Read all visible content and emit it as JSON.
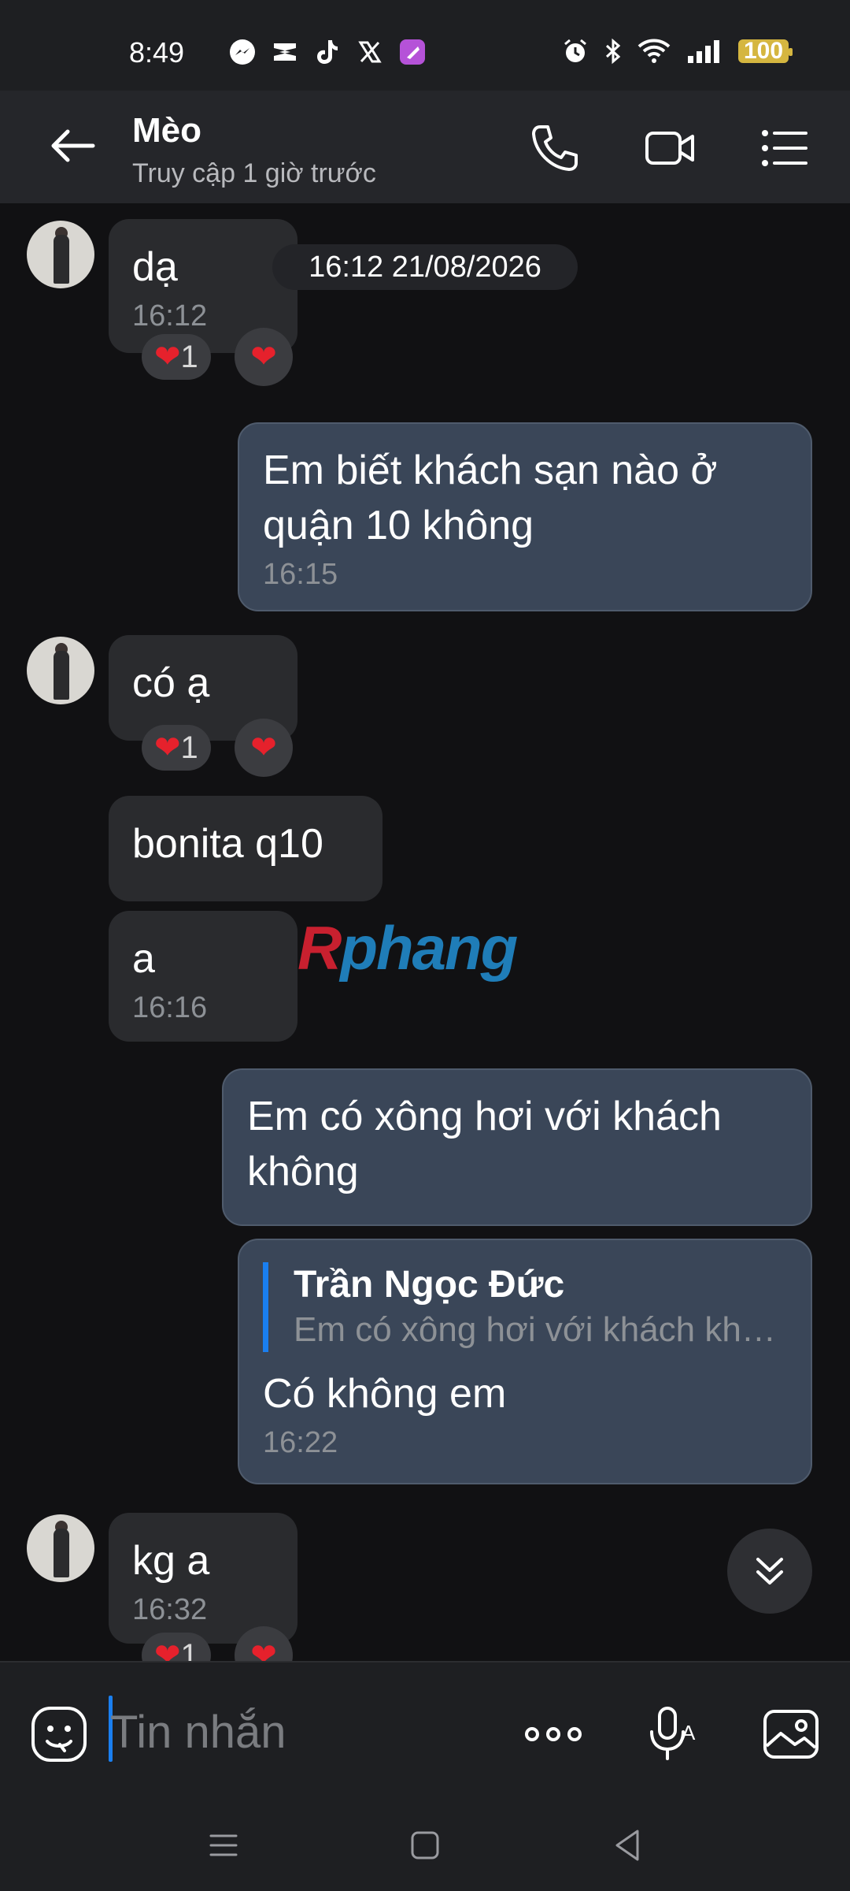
{
  "status_bar": {
    "time": "8:49",
    "battery": "100",
    "app_icons": [
      "messenger-icon",
      "capcut-icon",
      "tiktok-icon",
      "x-icon",
      "shortcut-app-icon"
    ],
    "system_icons": [
      "alarm-icon",
      "bluetooth-icon",
      "wifi-icon",
      "signal-icon",
      "battery-icon"
    ]
  },
  "header": {
    "name": "Mèo",
    "status": "Truy cập 1 giờ trước",
    "icons": [
      "back-arrow-icon",
      "phone-icon",
      "video-call-icon",
      "menu-list-icon"
    ]
  },
  "chat": {
    "date_separator": "16:12 21/08/2026",
    "messages": [
      {
        "from": "other",
        "text": "dạ",
        "time": "16:12",
        "reaction_count": "1"
      },
      {
        "from": "me",
        "text": "Em biết khách sạn nào ở quận 10 không",
        "time": "16:15"
      },
      {
        "from": "other",
        "text": "có ạ",
        "reaction_count": "1"
      },
      {
        "from": "other",
        "text": "bonita q10"
      },
      {
        "from": "other",
        "text": "a",
        "time": "16:16"
      },
      {
        "from": "me",
        "text": "Em có xông hơi với khách không"
      },
      {
        "from": "me",
        "reply_author": "Trần Ngọc Đức",
        "reply_text": "Em có xông hơi với khách không",
        "text": "Có không em",
        "time": "16:22"
      },
      {
        "from": "other",
        "text": "kg a",
        "time": "16:32",
        "reaction_count": "1"
      }
    ]
  },
  "watermark": {
    "part1": "R",
    "part2": "phang"
  },
  "composer": {
    "placeholder": "Tin nhắn",
    "icons": [
      "emoji-sticker-icon",
      "more-options-icon",
      "voice-to-text-icon",
      "image-gallery-icon"
    ]
  },
  "colors": {
    "background": "#111113",
    "incoming_bubble": "#2a2b2e",
    "outgoing_bubble": "#3a4658",
    "accent": "#1a7ff0",
    "heart": "#e6212c"
  }
}
